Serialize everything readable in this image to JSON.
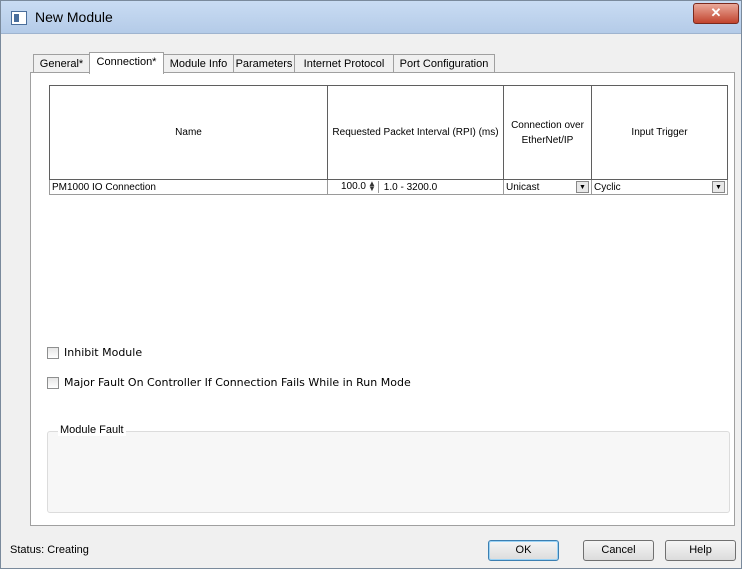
{
  "window": {
    "title": "New Module",
    "close_label": "✕"
  },
  "tabs": [
    {
      "label": "General*",
      "active": false
    },
    {
      "label": "Connection*",
      "active": true
    },
    {
      "label": "Module Info",
      "active": false
    },
    {
      "label": "Parameters",
      "active": false
    },
    {
      "label": "Internet Protocol",
      "active": false
    },
    {
      "label": "Port Configuration",
      "active": false
    }
  ],
  "connection_table": {
    "headers": {
      "name": "Name",
      "rpi": "Requested Packet Interval (RPI) (ms)",
      "connection_over": "Connection over EtherNet/IP",
      "input_trigger": "Input Trigger"
    },
    "row": {
      "name": "PM1000 IO Connection",
      "rpi_value": "100.0",
      "rpi_range": "1.0 - 3200.0",
      "connection_over": "Unicast",
      "input_trigger": "Cyclic"
    }
  },
  "options": {
    "inhibit_label": "Inhibit Module",
    "inhibit_checked": false,
    "major_fault_label": "Major Fault On Controller If Connection Fails While in Run Mode",
    "major_fault_checked": false
  },
  "module_fault": {
    "label": "Module Fault",
    "text": ""
  },
  "status": {
    "text": "Status: Creating"
  },
  "buttons": {
    "ok": "OK",
    "cancel": "Cancel",
    "help": "Help"
  }
}
